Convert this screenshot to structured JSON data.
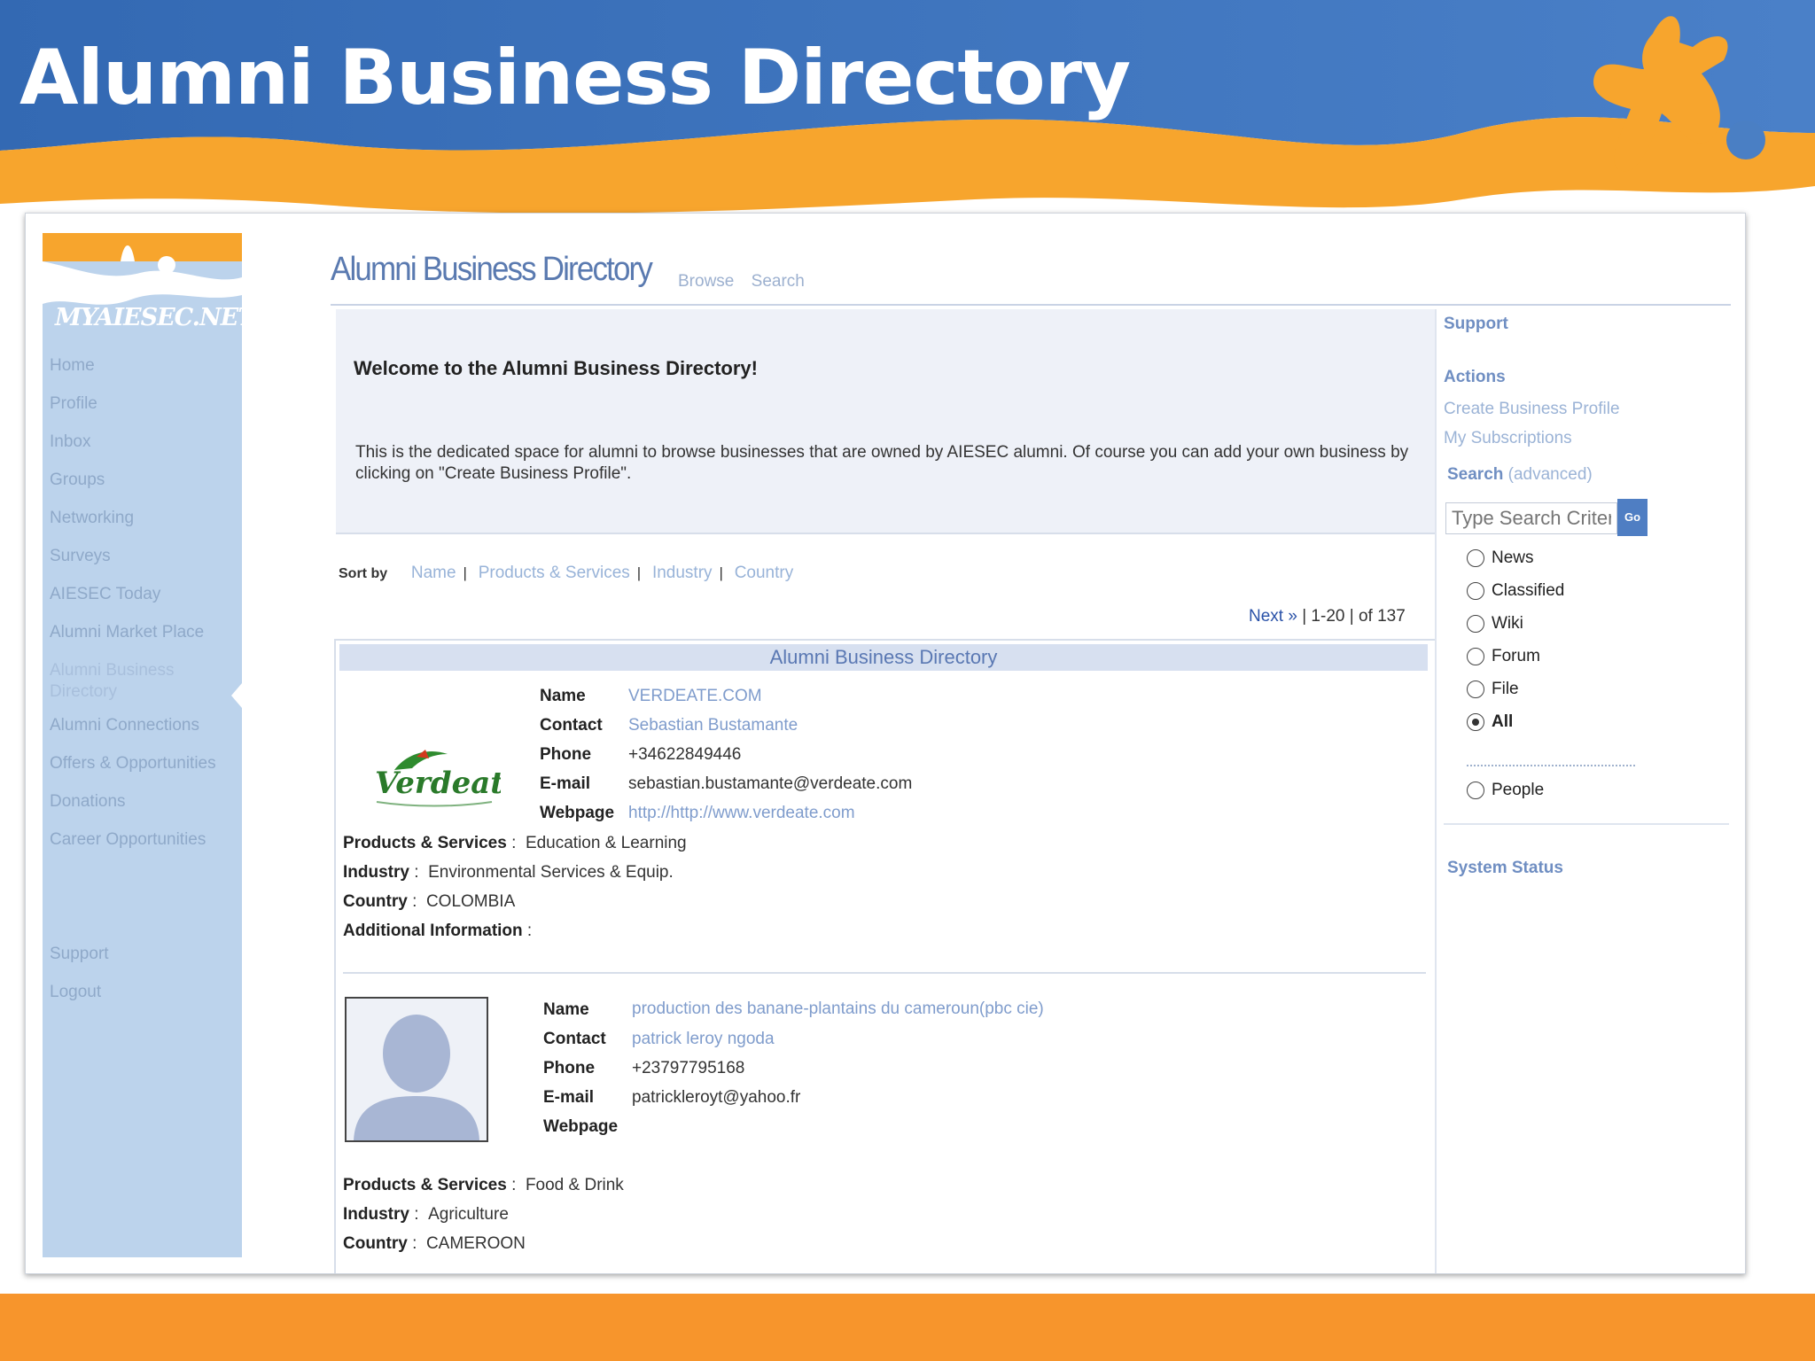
{
  "slide": {
    "title": "Alumni Business Directory",
    "brand": "MYAIESEC.NET",
    "colors": {
      "header_blue": "#3c74bd",
      "accent_orange": "#f7952c",
      "link_blue": "#7f9ccc"
    }
  },
  "nav": {
    "logo": "MYAIESEC.NET",
    "items": [
      {
        "label": "Home"
      },
      {
        "label": "Profile"
      },
      {
        "label": "Inbox"
      },
      {
        "label": "Groups"
      },
      {
        "label": "Networking"
      },
      {
        "label": "Surveys"
      },
      {
        "label": "AIESEC Today"
      },
      {
        "label": "Alumni Market Place"
      },
      {
        "label": "Alumni Business Directory"
      },
      {
        "label": "Alumni Connections"
      },
      {
        "label": "Offers & Opportunities"
      },
      {
        "label": "Donations"
      },
      {
        "label": "Career Opportunities"
      }
    ],
    "bottom": [
      {
        "label": "Support"
      },
      {
        "label": "Logout"
      }
    ]
  },
  "page": {
    "heading": "Alumni Business Directory",
    "tabs": [
      "Browse",
      "Search"
    ],
    "welcome_title": "Welcome to the Alumni Business Directory!",
    "welcome_body": "This is the dedicated space for alumni to browse businesses that are owned by AIESEC alumni. Of course you can add your own business by clicking on \"Create Business Profile\"."
  },
  "sort": {
    "label": "Sort by",
    "options": [
      "Name",
      "Products & Services",
      "Industry",
      "Country"
    ]
  },
  "pager": {
    "next": "Next »",
    "range": "1-20",
    "total": "of 137"
  },
  "results": {
    "header": "Alumni Business Directory",
    "labels": {
      "name": "Name",
      "contact": "Contact",
      "phone": "Phone",
      "email": "E-mail",
      "webpage": "Webpage",
      "products": "Products & Services",
      "industry": "Industry",
      "country": "Country",
      "additional": "Additional Information"
    },
    "entries": [
      {
        "logo_text": "Verdeate",
        "name": "VERDEATE.COM",
        "contact": "Sebastian  Bustamante",
        "phone": "+34622849446",
        "email": "sebastian.bustamante@verdeate.com",
        "webpage": "http://http://www.verdeate.com",
        "products": "Education & Learning",
        "industry": "Environmental Services & Equip.",
        "country": "COLOMBIA",
        "additional": ""
      },
      {
        "name": "production des banane-plantains du cameroun(pbc cie)",
        "contact": "patrick leroy  ngoda",
        "phone": "+23797795168",
        "email": "patrickleroyt@yahoo.fr",
        "webpage": "",
        "products": "Food & Drink",
        "industry": "Agriculture",
        "country": "CAMEROON"
      }
    ]
  },
  "sidebar_right": {
    "support": "Support",
    "actions_title": "Actions",
    "actions": [
      "Create Business Profile",
      "My Subscriptions"
    ],
    "search_title": "Search",
    "search_advanced": "(advanced)",
    "search_placeholder": "Type Search Criteria",
    "go_label": "Go",
    "radios": [
      {
        "label": "News",
        "selected": false
      },
      {
        "label": "Classified",
        "selected": false
      },
      {
        "label": "Wiki",
        "selected": false
      },
      {
        "label": "Forum",
        "selected": false
      },
      {
        "label": "File",
        "selected": false
      },
      {
        "label": "All",
        "selected": true
      }
    ],
    "people": "People",
    "system_status": "System Status"
  }
}
